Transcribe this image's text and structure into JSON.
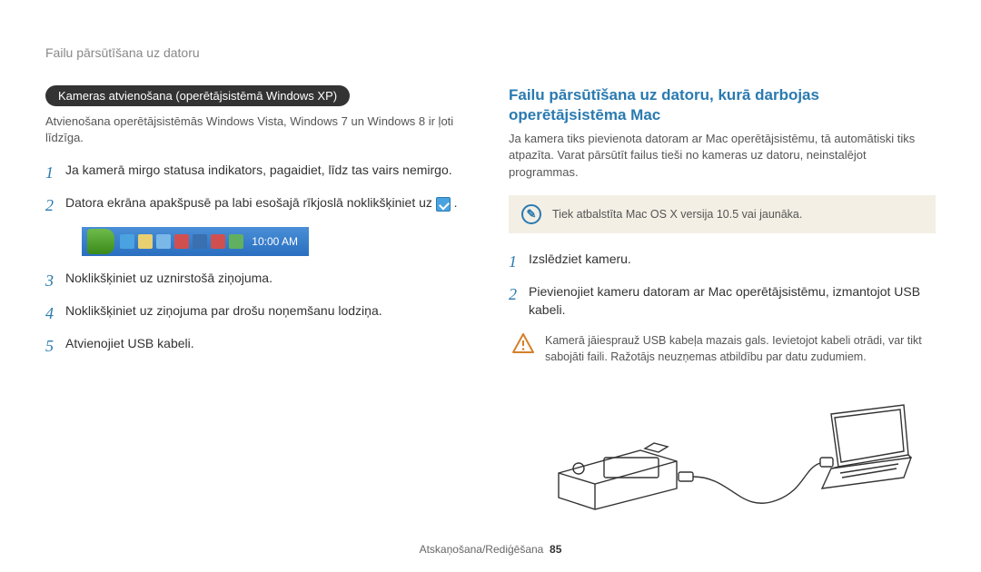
{
  "header": "Failu pārsūtīšana uz datoru",
  "left": {
    "pill": "Kameras atvienošana (operētājsistēmā Windows XP)",
    "intro": "Atvienošana operētājsistēmās Windows Vista, Windows 7 un Windows 8 ir ļoti līdzīga.",
    "steps": [
      "Ja kamerā mirgo statusa indikators, pagaidiet, līdz tas vairs nemirgo.",
      "Datora ekrāna apakšpusē pa labi esošajā rīkjoslā noklikšķiniet uz",
      "Noklikšķiniet uz uznirstošā ziņojuma.",
      "Noklikšķiniet uz ziņojuma par drošu noņemšanu lodziņa.",
      "Atvienojiet USB kabeli."
    ],
    "taskbar_time": "10:00 AM"
  },
  "right": {
    "title": "Failu pārsūtīšana uz datoru, kurā darbojas operētājsistēma Mac",
    "intro": "Ja kamera tiks pievienota datoram ar Mac operētājsistēmu, tā automātiski tiks atpazīta. Varat pārsūtīt failus tieši no kameras uz datoru, neinstalējot programmas.",
    "note": "Tiek atbalstīta Mac OS X versija 10.5 vai jaunāka.",
    "steps": [
      "Izslēdziet kameru.",
      "Pievienojiet kameru datoram ar Mac operētājsistēmu, izmantojot USB kabeli."
    ],
    "warning": "Kamerā jāiesprauž USB kabeļa mazais gals. Ievietojot kabeli otrādi, var tikt sabojāti faili. Ražotājs neuzņemas atbildību par datu zudumiem."
  },
  "footer": {
    "section": "Atskaņošana/Rediģēšana",
    "page": "85"
  }
}
